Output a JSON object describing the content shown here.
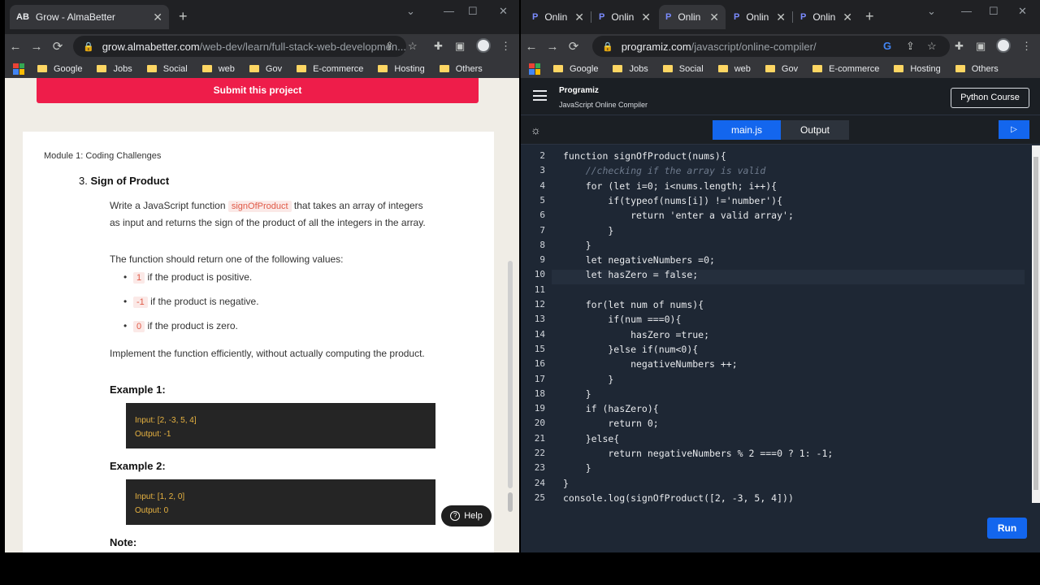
{
  "left": {
    "tab": {
      "title": "Grow - AlmaBetter",
      "favicon": "AB"
    },
    "url": {
      "host": "grow.almabetter.com",
      "path": "/web-dev/learn/full-stack-web-developmen..."
    },
    "bookmarks": [
      "Google",
      "Jobs",
      "Social",
      "web",
      "Gov",
      "E-commerce",
      "Hosting",
      "Others"
    ],
    "submit_label": "Submit this project",
    "module": "Module 1: Coding Challenges",
    "problem_number": "3.",
    "problem_title": "Sign of Product",
    "desc_pre": "Write a JavaScript function",
    "desc_code": "signOfProduct",
    "desc_post": "that takes an array of integers as input and returns the sign of the product of all the integers in the array.",
    "return_intro": "The function should return one of the following values:",
    "bullets": [
      {
        "code": "1",
        "text": "if the product is positive."
      },
      {
        "code": "-1",
        "text": "if the product is negative."
      },
      {
        "code": "0",
        "text": "if the product is zero."
      }
    ],
    "implement": "Implement the function efficiently, without actually computing the product.",
    "example1_title": "Example 1:",
    "example1_input": "Input: [2, -3, 5, 4]",
    "example1_output": "Output: -1",
    "example2_title": "Example 2:",
    "example2_input": "Input: [1, 2, 0]",
    "example2_output": "Output: 0",
    "note_title": "Note:",
    "help_label": "Help"
  },
  "right": {
    "tabs": [
      "Onlin",
      "Onlin",
      "Onlin",
      "Onlin",
      "Onlin"
    ],
    "url": {
      "host": "programiz.com",
      "path": "/javascript/online-compiler/"
    },
    "bookmarks": [
      "Google",
      "Jobs",
      "Social",
      "web",
      "Gov",
      "E-commerce",
      "Hosting",
      "Others"
    ],
    "brand": "Programiz",
    "brand_sub": "JavaScript Online Compiler",
    "python_course": "Python Course",
    "tab_main": "main.js",
    "tab_output": "Output",
    "run_label": "Run",
    "line_numbers": [
      "2",
      "3",
      "4",
      "5",
      "6",
      "7",
      "8",
      "9",
      "10",
      "11",
      "12",
      "13",
      "14",
      "15",
      "16",
      "17",
      "18",
      "19",
      "20",
      "21",
      "22",
      "23",
      "24",
      "25"
    ],
    "code_lines": [
      "function signOfProduct(nums){",
      "    //checking if the array is valid",
      "    for (let i=0; i<nums.length; i++){",
      "        if(typeof(nums[i]) !='number'){",
      "            return 'enter a valid array';",
      "        }",
      "    }",
      "    let negativeNumbers =0;",
      "    let hasZero = false;",
      "",
      "    for(let num of nums){",
      "        if(num ===0){",
      "            hasZero =true;",
      "        }else if(num<0){",
      "            negativeNumbers ++;",
      "        }",
      "    }",
      "    if (hasZero){",
      "        return 0;",
      "    }else{",
      "        return negativeNumbers % 2 ===0 ? 1: -1;",
      "    }",
      "}",
      "console.log(signOfProduct([2, -3, 5, 4]))"
    ]
  }
}
